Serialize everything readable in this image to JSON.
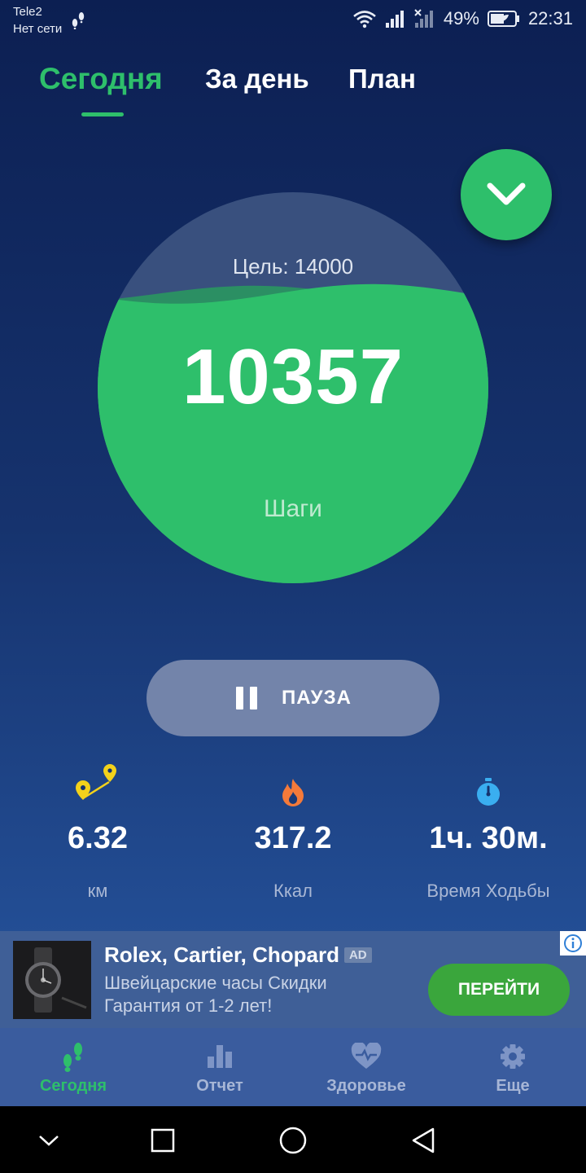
{
  "status_bar": {
    "carrier": "Tele2",
    "network_status": "Нет сети",
    "battery": "49%",
    "time": "22:31"
  },
  "tabs": [
    {
      "label": "Сегодня",
      "active": true
    },
    {
      "label": "За день",
      "active": false
    },
    {
      "label": "План",
      "active": false
    }
  ],
  "progress": {
    "goal_label": "Цель: 14000",
    "steps": "10357",
    "steps_label": "Шаги",
    "fill_fraction": 0.74
  },
  "pause_button": {
    "label": "ПАУЗА"
  },
  "stats": [
    {
      "icon": "route-pin-icon",
      "value": "6.32",
      "label": "км"
    },
    {
      "icon": "flame-icon",
      "value": "317.2",
      "label": "Ккал"
    },
    {
      "icon": "stopwatch-icon",
      "value": "1ч. 30м.",
      "label": "Время Ходьбы"
    }
  ],
  "ad": {
    "title": "Rolex, Cartier, Chopard",
    "badge": "AD",
    "description_line1": "Швейцарские часы Скидки",
    "description_line2": "Гарантия от 1-2 лет!",
    "cta": "ПЕРЕЙТИ"
  },
  "bottom_nav": [
    {
      "icon": "footsteps-icon",
      "label": "Сегодня",
      "active": true
    },
    {
      "icon": "bar-chart-icon",
      "label": "Отчет",
      "active": false
    },
    {
      "icon": "heart-pulse-icon",
      "label": "Здоровье",
      "active": false
    },
    {
      "icon": "gear-icon",
      "label": "Еще",
      "active": false
    }
  ],
  "colors": {
    "accent": "#2ebf6b",
    "background_top": "#0c1f52",
    "background_bottom": "#2a5aa3"
  }
}
